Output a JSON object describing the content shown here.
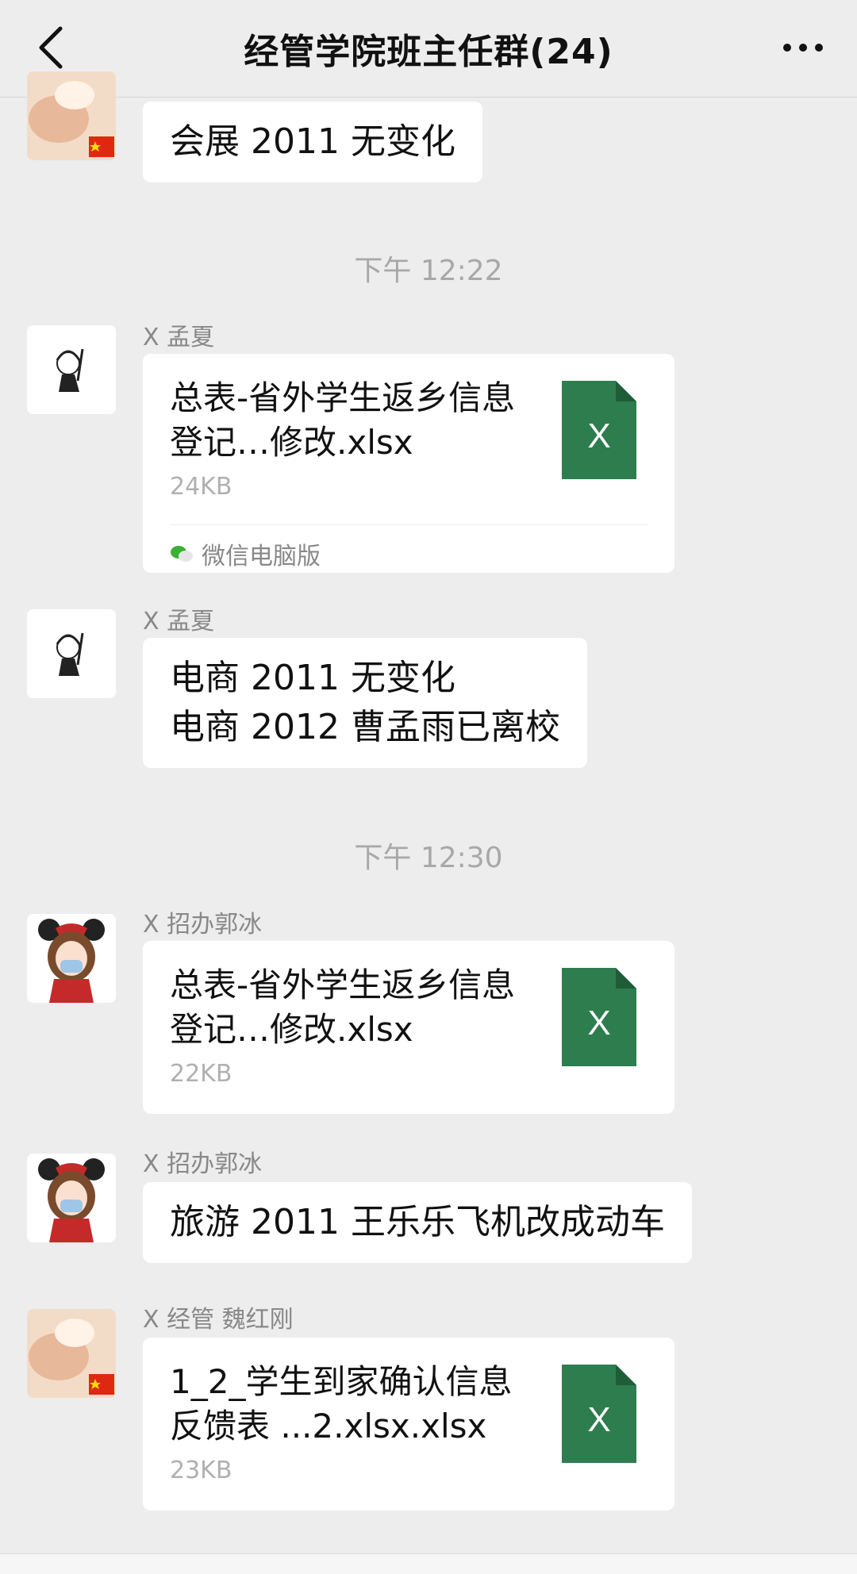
{
  "header": {
    "title": "经管学院班主任群(24)"
  },
  "messages": {
    "m0": {
      "text": "会展 2011 无变化"
    },
    "t1": "下午 12:22",
    "m1": {
      "sender": "X  孟夏",
      "file_name": "总表-省外学生返乡信息登记…修改.xlsx",
      "file_size": "24KB",
      "source": "微信电脑版"
    },
    "m2": {
      "sender": "X  孟夏",
      "line1": "电商 2011 无变化",
      "line2": "电商 2012 曹孟雨已离校"
    },
    "t2": "下午 12:30",
    "m3": {
      "sender": "X  招办郭冰",
      "file_name": "总表-省外学生返乡信息登记…修改.xlsx",
      "file_size": "22KB"
    },
    "m4": {
      "sender": "X  招办郭冰",
      "text": "旅游 2011  王乐乐飞机改成动车"
    },
    "m5": {
      "sender": "X 经管  魏红刚",
      "file_name": "1_2_学生到家确认信息反馈表 ...2.xlsx.xlsx",
      "file_size": "23KB"
    }
  },
  "colors": {
    "excel_green": "#2e7d4f",
    "background": "#ededed",
    "bubble": "#ffffff"
  },
  "icons": {
    "back": "chevron-left-icon",
    "more": "more-dots-icon",
    "file": "excel-file-icon"
  }
}
